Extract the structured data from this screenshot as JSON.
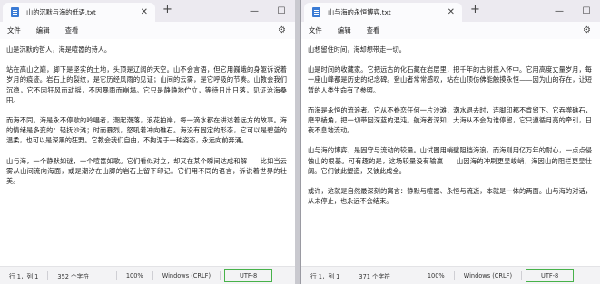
{
  "left": {
    "tab_title": "山的沉默与海的低语.txt",
    "menu": [
      "文件",
      "编辑",
      "查看"
    ],
    "paragraphs": [
      "山是沉默的哲人，海是喧嚣的诗人。",
      "站在高山之巅，脚下是坚实的土地，头顶是辽阔的天空。山不会言语，但它用巍峨的身躯诉说着岁月的痕迹。岩石上的裂纹，是它历经风雨的见证；山间的云雾，是它呼吸的节奏。山教会我们沉稳，它不因狂风而动摇，不因暴雨而崩塌。它只是静静地伫立，等待日出日落，见证沧海桑田。",
      "而海不同。海是永不停歇的吟唱者，潮起潮落，浪花拍岸，每一滴水都在讲述着远方的故事。海的情绪是多变的：轻抚沙滩；时而暴烈，怒吼着冲向礁石。海没有固定的形态，它可以是碧蓝的温柔，也可以是深黑的狂野。它教会我们自由，不拘泥于一种姿态，永远向前奔涌。",
      "山与海，一个静默如谜，一个喧嚣如歌。它们看似对立，却又在某个瞬间达成和解——比如当云雾从山间流向海面，或是潮汐在山脚的岩石上留下印记。它们用不同的语言，诉说着世界的壮美。"
    ],
    "status": {
      "position": "行 1，列 1",
      "chars": "352 个字符",
      "zoom": "100%",
      "line_ending": "Windows (CRLF)",
      "encoding": "UTF-8"
    }
  },
  "right": {
    "tab_title": "山与海的永恒博弈.txt",
    "menu": [
      "文件",
      "编辑",
      "查看"
    ],
    "paragraphs": [
      "山想留住时间，海却想带走一切。",
      "山是时间的收藏家。它把远古的化石藏在岩层里，把千年的古树揽入怀中。它用高度丈量岁月，每一座山峰都是历史的纪念碑。登山者常常感叹，站在山顶仿佛能触摸永恒——因为山的存在，让短暂的人类生命有了参照。",
      "而海是永恒的流浪者。它从不眷恋任何一片沙滩，潮水退去时，连脚印都不肯留下。它吞噬礁石，磨平棱角，把一切带回深蓝的混沌。航海者深知，大海从不会为谁停留，它只遵循月亮的牵引，日夜不息地流动。",
      "山与海的博弈，是固守与流动的较量。山试图用峭壁阻挡海浪，而海则用亿万年的耐心，一点点侵蚀山的根基。可有趣的是，这场较量没有输赢——山因海的冲刷更显峻峭，海因山的阻拦更显壮阔。它们彼此塑造，又彼此成全。",
      "或许，这就是自然最深刻的寓言：静默与喧嚣、永恒与流逝，本就是一体的两面。山与海的对话，从未停止，也永远不会结束。"
    ],
    "status": {
      "position": "行 1，列 1",
      "chars": "371 个字符",
      "zoom": "100%",
      "line_ending": "Windows (CRLF)",
      "encoding": "UTF-8"
    }
  },
  "icons": {
    "file": "notepad-file-icon",
    "close": "close-icon",
    "add": "plus-icon",
    "minimize": "minimize-icon",
    "maximize": "maximize-icon",
    "settings": "gear-icon"
  },
  "colors": {
    "accent": "#3a7bd5",
    "encoding_highlight": "#47b24a",
    "titlebar": "#eceaf0"
  }
}
